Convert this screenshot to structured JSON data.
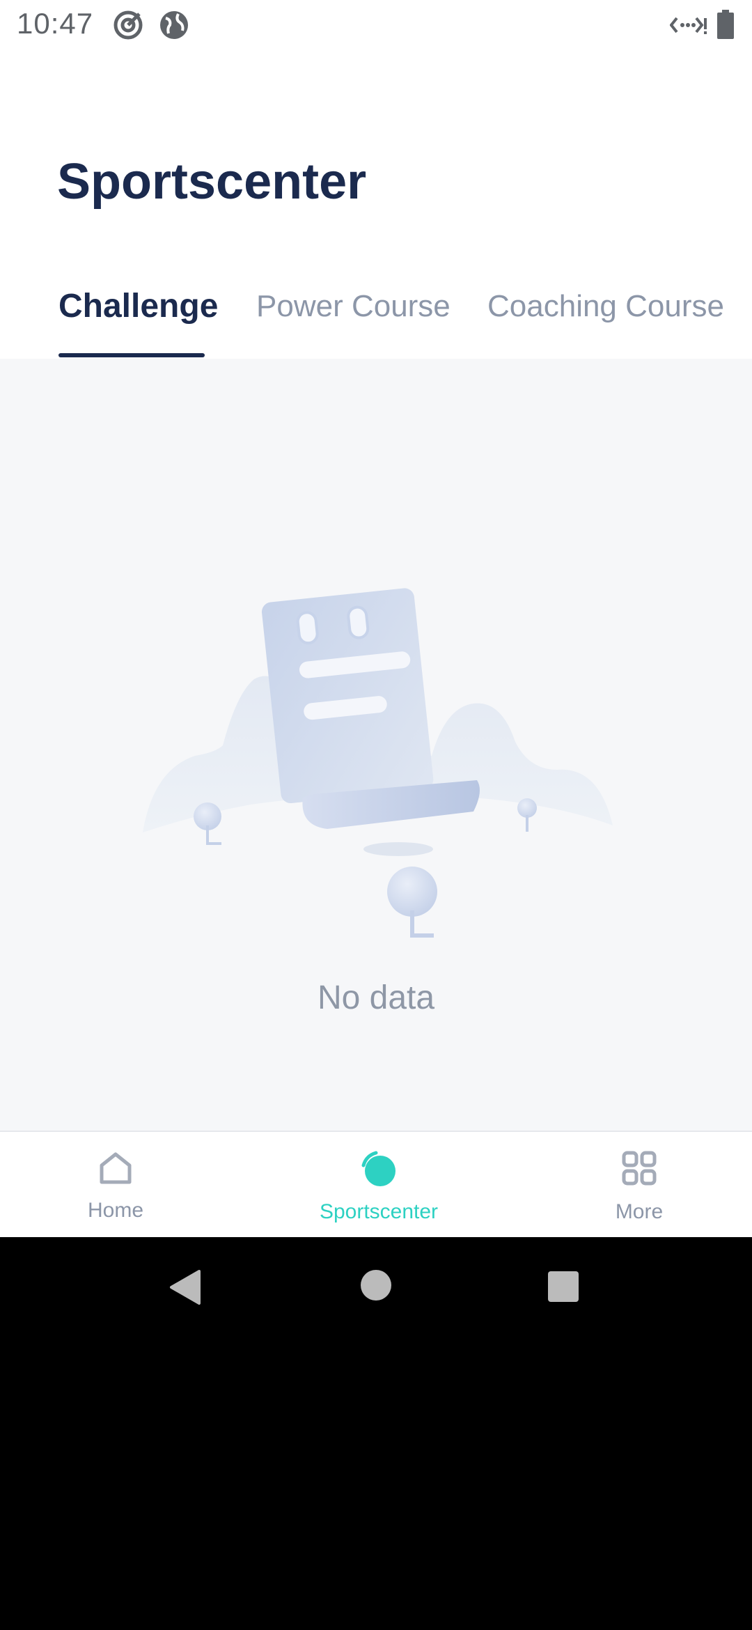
{
  "status_bar": {
    "time": "10:47",
    "icons": [
      "target-icon",
      "globe-icon",
      "network-icon",
      "battery-icon"
    ]
  },
  "header": {
    "title": "Sportscenter"
  },
  "tabs": [
    {
      "label": "Challenge",
      "active": true
    },
    {
      "label": "Power Course",
      "active": false
    },
    {
      "label": "Coaching Course",
      "active": false
    }
  ],
  "empty_state": {
    "message": "No data",
    "icon": "empty-notepad-illustration"
  },
  "bottom_nav": [
    {
      "label": "Home",
      "icon": "home-icon",
      "active": false
    },
    {
      "label": "Sportscenter",
      "icon": "sportscenter-icon",
      "active": true
    },
    {
      "label": "More",
      "icon": "grid-icon",
      "active": false
    }
  ],
  "colors": {
    "title": "#1b2a4e",
    "tab_inactive": "#8c96a8",
    "accent": "#2dd1c2",
    "content_bg": "#f6f7f9"
  },
  "system_nav": [
    "back-icon",
    "home-circle-icon",
    "recents-icon"
  ]
}
